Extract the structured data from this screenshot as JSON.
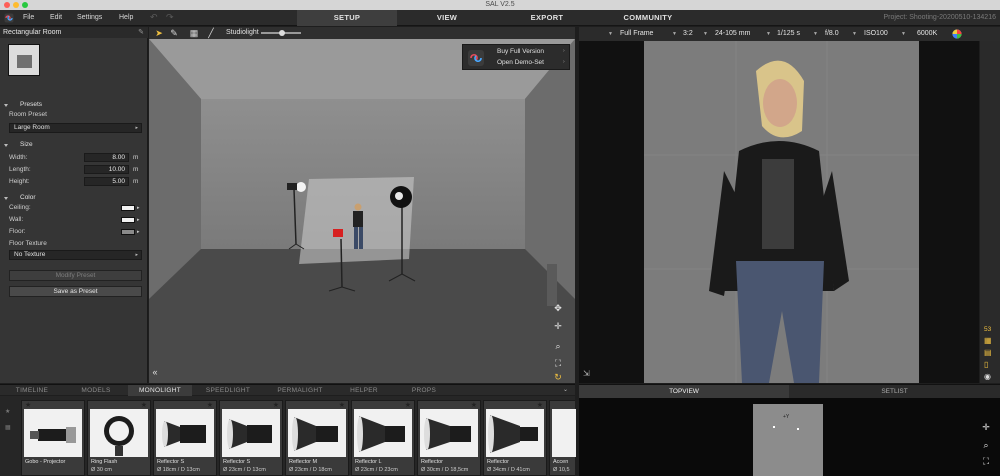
{
  "window": {
    "title": "SAL V2.5"
  },
  "menu": {
    "items": [
      "File",
      "Edit",
      "Settings",
      "Help"
    ]
  },
  "main_tabs": [
    "SETUP",
    "VIEW",
    "EXPORT",
    "COMMUNITY"
  ],
  "project": "Project: Shooting-20200510-134216",
  "left_panel": {
    "title": "Rectangular Room",
    "presets": {
      "header": "Presets",
      "room_preset_label": "Room Preset",
      "room_preset_value": "Large Room"
    },
    "size": {
      "header": "Size",
      "width_label": "Width:",
      "width_value": "8.00",
      "length_label": "Length:",
      "length_value": "10.00",
      "height_label": "Height:",
      "height_value": "5.00",
      "unit": "m"
    },
    "color": {
      "header": "Color",
      "ceiling_label": "Ceiling:",
      "ceiling_color": "#f2f2f2",
      "wall_label": "Wall:",
      "wall_color": "#f2f2f2",
      "floor_label": "Floor:",
      "floor_color": "#8a8a8a",
      "floor_texture_label": "Floor Texture",
      "floor_texture_value": "No Texture"
    },
    "modify_preset": "Modify Preset",
    "save_preset": "Save as Preset"
  },
  "viewport_toolbar": {
    "light_label": "Studiolight"
  },
  "promo": {
    "buy": "Buy Full Version",
    "demo": "Open Demo-Set"
  },
  "camera_toolbar": {
    "format": "Full Frame",
    "ratio": "3:2",
    "lens": "24-105 mm",
    "shutter": "1/125 s",
    "aperture": "f/8.0",
    "iso": "ISO100",
    "white_balance": "6000K"
  },
  "side_zoom": "53",
  "bottom_tabs": [
    "TIMELINE",
    "MODELS",
    "MONOLIGHT",
    "SPEEDLIGHT",
    "PERMALIGHT",
    "HELPER",
    "PROPS"
  ],
  "active_bottom_tab": "MONOLIGHT",
  "lights": [
    {
      "name": "Gobo - Projector",
      "dim": ""
    },
    {
      "name": "Ring Flash",
      "dim": "Ø 30 cm"
    },
    {
      "name": "Reflector S",
      "dim": "Ø 18cm / D 13cm"
    },
    {
      "name": "Reflector S",
      "dim": "Ø 23cm / D 13cm"
    },
    {
      "name": "Reflector M",
      "dim": "Ø 23cm / D 18cm"
    },
    {
      "name": "Reflector L",
      "dim": "Ø 23cm / D 23cm"
    },
    {
      "name": "Reflector",
      "dim": "Ø 30cm / D 18,5cm"
    },
    {
      "name": "Reflector",
      "dim": "Ø 34cm / D 41cm"
    },
    {
      "name": "Accen",
      "dim": "Ø 10,5"
    }
  ],
  "right_bottom_tabs": [
    "TOPVIEW",
    "SETLIST"
  ],
  "topview_label": "+Y"
}
